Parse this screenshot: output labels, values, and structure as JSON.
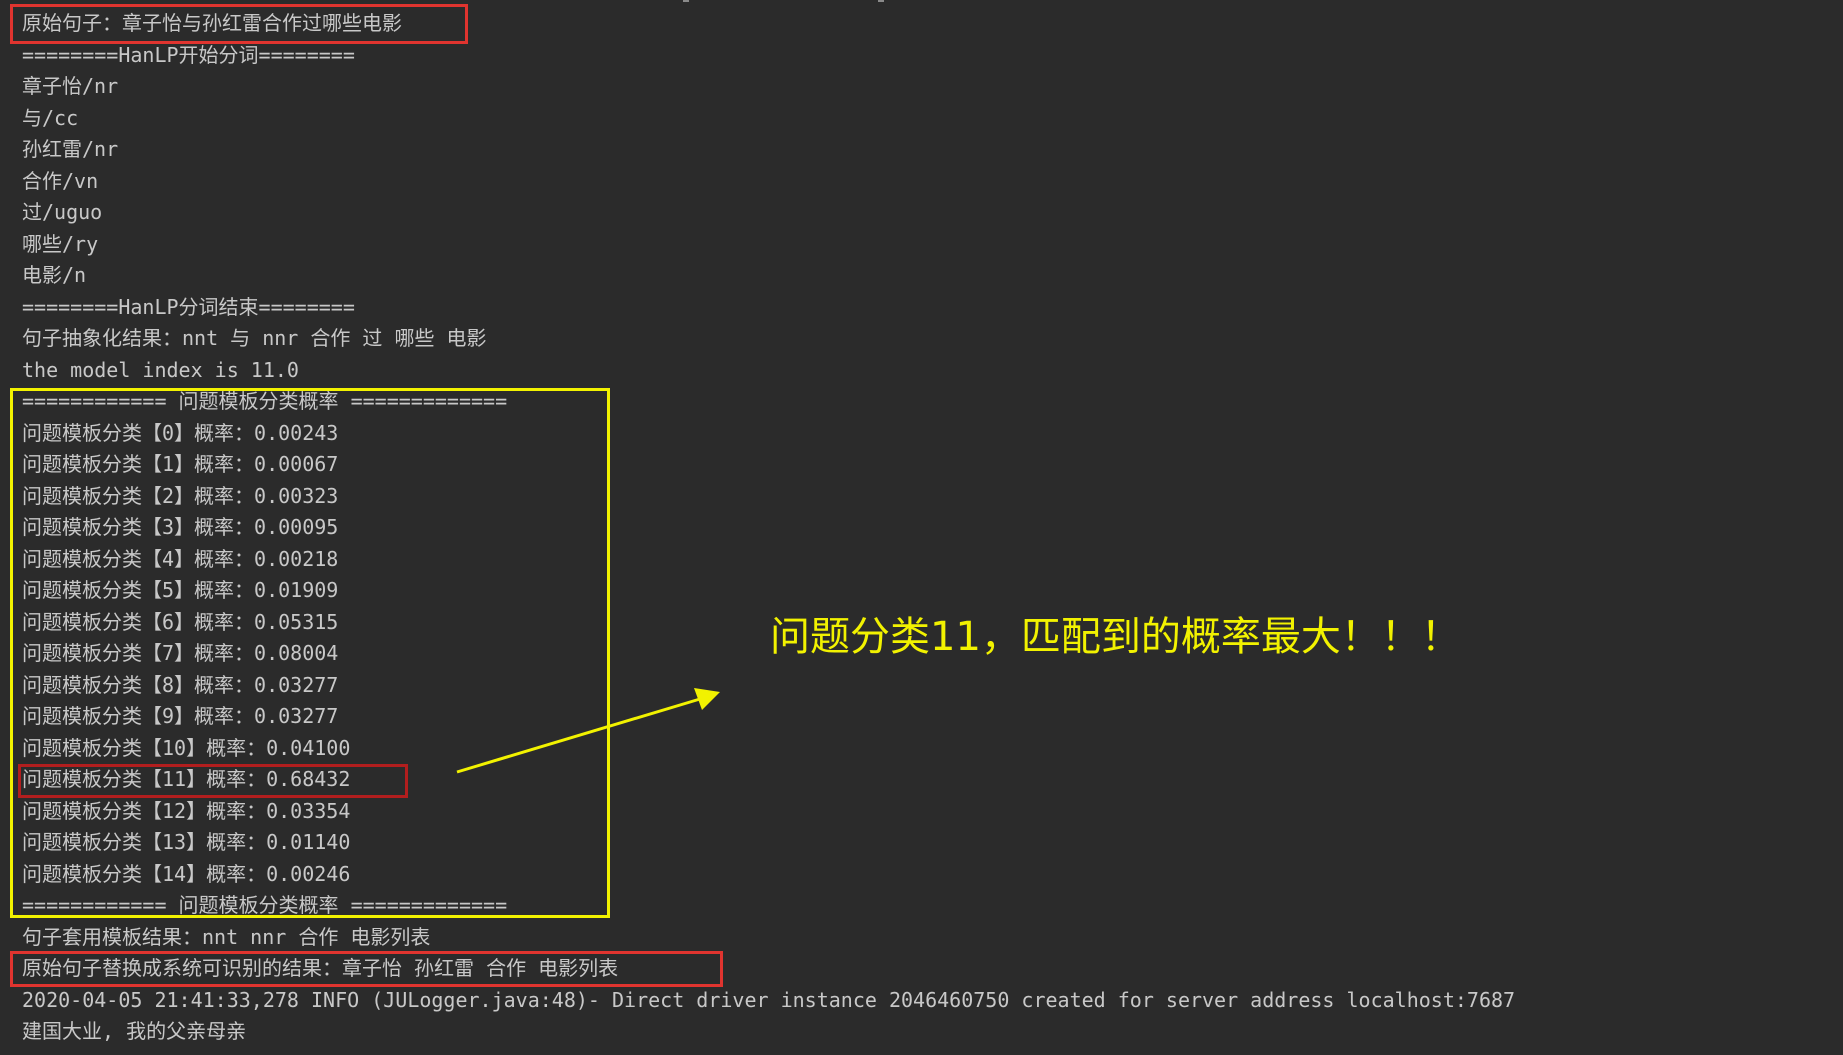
{
  "console": {
    "lines": [
      "原始句子：章子怡与孙红雷合作过哪些电影",
      "========HanLP开始分词========",
      "章子怡/nr",
      "与/cc",
      "孙红雷/nr",
      "合作/vn",
      "过/uguo",
      "哪些/ry",
      "电影/n",
      "========HanLP分词结束========",
      "句子抽象化结果：nnt 与 nnr 合作 过 哪些 电影",
      "the model index is 11.0",
      "============ 问题模板分类概率 =============",
      "问题模板分类【0】概率：0.00243",
      "问题模板分类【1】概率：0.00067",
      "问题模板分类【2】概率：0.00323",
      "问题模板分类【3】概率：0.00095",
      "问题模板分类【4】概率：0.00218",
      "问题模板分类【5】概率：0.01909",
      "问题模板分类【6】概率：0.05315",
      "问题模板分类【7】概率：0.08004",
      "问题模板分类【8】概率：0.03277",
      "问题模板分类【9】概率：0.03277",
      "问题模板分类【10】概率：0.04100",
      "问题模板分类【11】概率：0.68432",
      "问题模板分类【12】概率：0.03354",
      "问题模板分类【13】概率：0.01140",
      "问题模板分类【14】概率：0.00246",
      "============ 问题模板分类概率 =============",
      "句子套用模板结果：nnt nnr 合作 电影列表",
      "原始句子替换成系统可识别的结果：章子怡 孙红雷 合作 电影列表",
      "2020-04-05 21:41:33,278 INFO (JULogger.java:48)- Direct driver instance 2046460750 created for server address localhost:7687",
      "建国大业, 我的父亲母亲"
    ]
  },
  "annotation": {
    "text": "问题分类11，匹配到的概率最大！！！"
  },
  "colors": {
    "background": "#2b2b2b",
    "text": "#c8c8c8",
    "highlight_red": "#e0342f",
    "highlight_dark_red": "#b21e1e",
    "highlight_yellow": "#f2f200"
  }
}
